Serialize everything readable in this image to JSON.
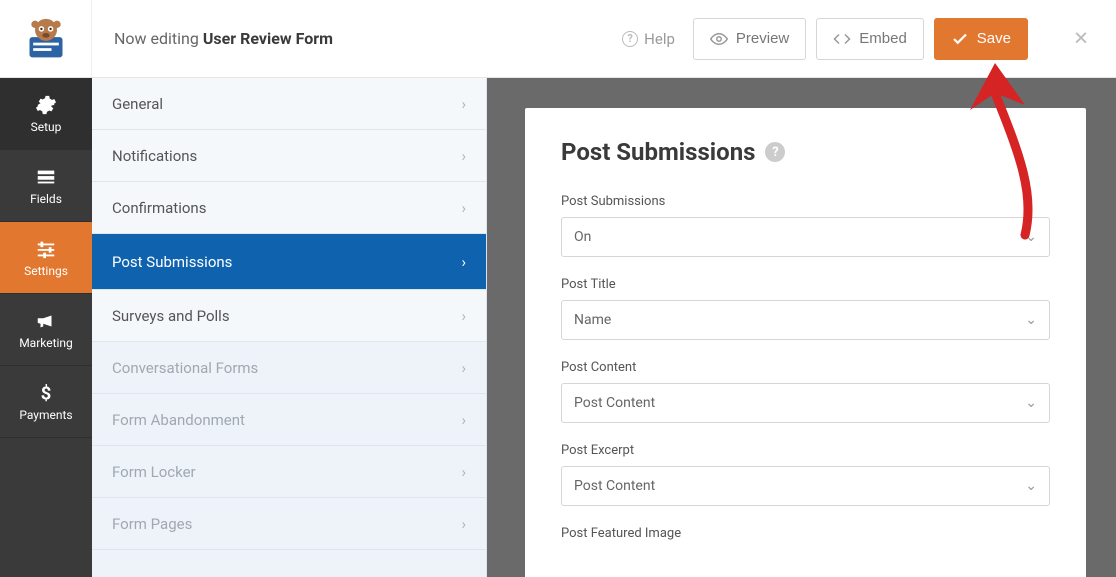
{
  "header": {
    "editing_prefix": "Now editing ",
    "form_name": "User Review Form",
    "help": "Help",
    "preview": "Preview",
    "embed": "Embed",
    "save": "Save"
  },
  "leftnav": {
    "setup": "Setup",
    "fields": "Fields",
    "settings": "Settings",
    "marketing": "Marketing",
    "payments": "Payments"
  },
  "settings_menu": {
    "items": [
      {
        "label": "General",
        "muted": false
      },
      {
        "label": "Notifications",
        "muted": false
      },
      {
        "label": "Confirmations",
        "muted": false
      },
      {
        "label": "Post Submissions",
        "active": true
      },
      {
        "label": "Surveys and Polls",
        "muted": false
      },
      {
        "label": "Conversational Forms",
        "muted": true
      },
      {
        "label": "Form Abandonment",
        "muted": true
      },
      {
        "label": "Form Locker",
        "muted": true
      },
      {
        "label": "Form Pages",
        "muted": true
      }
    ]
  },
  "panel": {
    "title": "Post Submissions",
    "fields": [
      {
        "label": "Post Submissions",
        "value": "On"
      },
      {
        "label": "Post Title",
        "value": "Name"
      },
      {
        "label": "Post Content",
        "value": "Post Content"
      },
      {
        "label": "Post Excerpt",
        "value": "Post Content"
      },
      {
        "label": "Post Featured Image",
        "value": ""
      }
    ]
  }
}
